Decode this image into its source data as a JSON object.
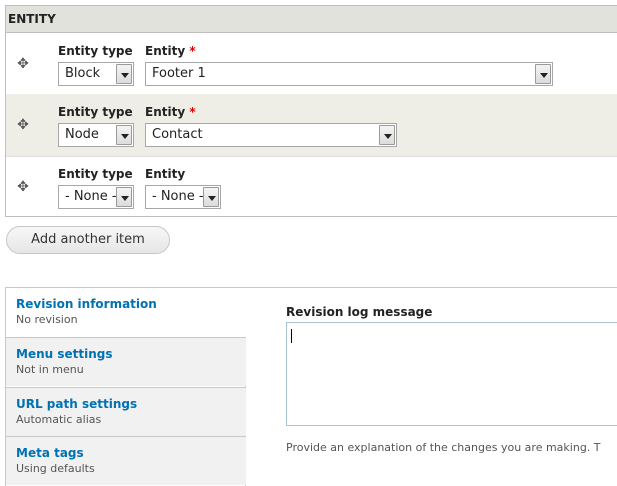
{
  "entity_table": {
    "header": "ENTITY",
    "rows": [
      {
        "entity_type_label": "Entity type",
        "entity_label": "Entity",
        "required_marker": "*",
        "entity_type_value": "Block",
        "entity_value": "Footer 1"
      },
      {
        "entity_type_label": "Entity type",
        "entity_label": "Entity",
        "required_marker": "*",
        "entity_type_value": "Node",
        "entity_value": "Contact"
      },
      {
        "entity_type_label": "Entity type",
        "entity_label": "Entity",
        "required_marker": "",
        "entity_type_value": "- None -",
        "entity_value": "- None -"
      }
    ],
    "drag_icon": "move-cross-icon",
    "add_button_label": "Add another item"
  },
  "vertical_tabs": [
    {
      "title": "Revision information",
      "summary": "No revision"
    },
    {
      "title": "Menu settings",
      "summary": "Not in menu"
    },
    {
      "title": "URL path settings",
      "summary": "Automatic alias"
    },
    {
      "title": "Meta tags",
      "summary": "Using defaults"
    }
  ],
  "revision_panel": {
    "log_label": "Revision log message",
    "log_value": "",
    "description": "Provide an explanation of the changes you are making. T"
  },
  "colors": {
    "link": "#0071b3",
    "required": "#e00000",
    "header_bg": "#e1e2dc",
    "even_row_bg": "#eeeee6"
  }
}
